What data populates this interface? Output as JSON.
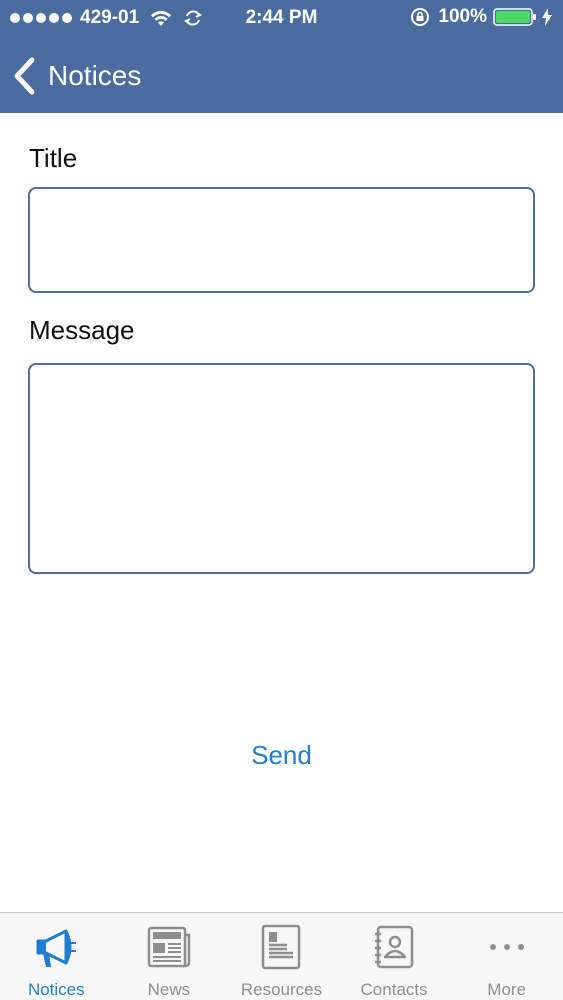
{
  "status_bar": {
    "carrier": "429-01",
    "time": "2:44 PM",
    "battery": "100%"
  },
  "nav": {
    "back_label": "Notices"
  },
  "form": {
    "title_label": "Title",
    "title_value": "",
    "message_label": "Message",
    "message_value": "",
    "send_label": "Send"
  },
  "tabs": [
    {
      "label": "Notices",
      "icon": "megaphone-icon",
      "active": true
    },
    {
      "label": "News",
      "icon": "newspaper-icon",
      "active": false
    },
    {
      "label": "Resources",
      "icon": "document-icon",
      "active": false
    },
    {
      "label": "Contacts",
      "icon": "contacts-book-icon",
      "active": false
    },
    {
      "label": "More",
      "icon": "more-dots-icon",
      "active": false
    }
  ],
  "colors": {
    "header_bg": "#4a6c9f",
    "accent": "#1f7ed4",
    "tab_inactive": "#8e8e8e",
    "battery": "#4cd964"
  }
}
